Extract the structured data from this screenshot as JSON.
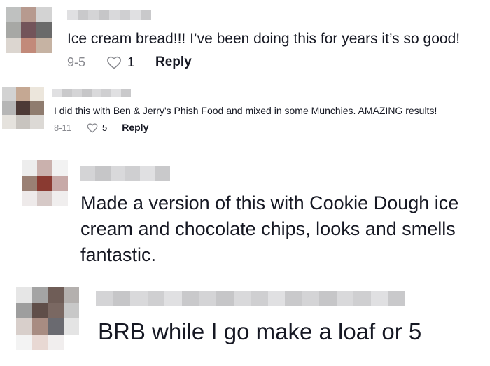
{
  "colors": {
    "text": "#161823",
    "meta": "#8a8b91",
    "background": "#ffffff",
    "blur": "#d6d6d8"
  },
  "comments": [
    {
      "text": "Ice cream bread!!! I’ve been doing this for years it’s so good!",
      "date": "9-5",
      "likes": "1",
      "reply_label": "Reply",
      "heart_icon": "heart-outline-icon",
      "avatar_colors": [
        "#bfc1c0",
        "#b79a8f",
        "#d3d3d3",
        "#a7a8a5",
        "#73545a",
        "#6a6a6a",
        "#dcd6d0",
        "#c28a7a",
        "#c6b3a3"
      ]
    },
    {
      "text": "I did this with Ben & Jerry's Phish Food and mixed in some Munchies. AMAZING results!",
      "date": "8-11",
      "likes": "5",
      "reply_label": "Reply",
      "heart_icon": "heart-outline-icon",
      "avatar_colors": [
        "#d2d2d2",
        "#c5a893",
        "#ece6dc",
        "#b6b6b6",
        "#4d3a36",
        "#8f7c6f",
        "#e5e2dd",
        "#c8c4bf",
        "#dcd9d5"
      ]
    },
    {
      "text": "Made a version of this with Cookie Dough ice cream and chocolate chips, looks and smells fantastic.",
      "avatar_colors": [
        "#ededed",
        "#cab1ad",
        "#f2f2f2",
        "#9a8074",
        "#8a3a31",
        "#c7a9a7",
        "#eeeaea",
        "#d6c9c7",
        "#f0eeee"
      ]
    },
    {
      "text": "BRB while I go make a loaf or 5",
      "avatar_colors": [
        "#e6e6e6",
        "#a4a4a4",
        "#6f5d57",
        "#b4b0ae",
        "#9e9e9e",
        "#5f4e49",
        "#7a6862",
        "#c8c8c8",
        "#d8cfcb",
        "#a88c82",
        "#6a6a70",
        "#e4e4e4",
        "#f3f3f3",
        "#e8d8d3",
        "#f1eeee",
        "#ffffff"
      ]
    }
  ]
}
